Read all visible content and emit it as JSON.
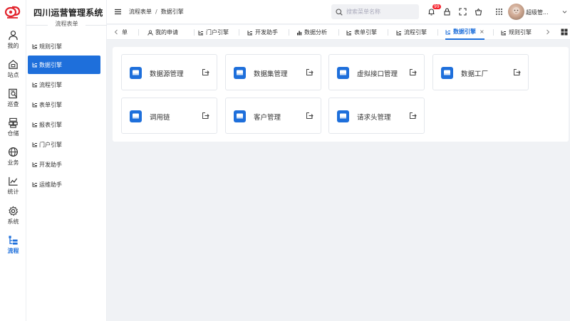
{
  "app": {
    "title": "四川运营管理系统"
  },
  "rail": {
    "items": [
      {
        "label": "我的",
        "icon": "user-icon"
      },
      {
        "label": "站点",
        "icon": "site-icon"
      },
      {
        "label": "巡查",
        "icon": "inspect-icon"
      },
      {
        "label": "仓储",
        "icon": "warehouse-icon"
      },
      {
        "label": "业务",
        "icon": "globe-icon"
      },
      {
        "label": "统计",
        "icon": "chart-icon"
      },
      {
        "label": "系统",
        "icon": "gear-icon"
      },
      {
        "label": "流程",
        "icon": "flow-icon",
        "active": true
      }
    ]
  },
  "sidebar": {
    "heading": "流程表单",
    "items": [
      {
        "label": "规则引擎"
      },
      {
        "label": "数据引擎",
        "active": true
      },
      {
        "label": "流程引擎"
      },
      {
        "label": "表单引擎"
      },
      {
        "label": "报表引擎"
      },
      {
        "label": "门户引擎"
      },
      {
        "label": "开发助手"
      },
      {
        "label": "运维助手"
      }
    ]
  },
  "header": {
    "breadcrumb": [
      "流程表单",
      "数据引擎"
    ],
    "breadcrumb_sep": "/",
    "search_placeholder": "搜索菜单名称",
    "notification_count": "99",
    "username": "超级管..."
  },
  "tabs": [
    {
      "label": "单",
      "icon": "none"
    },
    {
      "label": "我的申请",
      "icon": "user-icon"
    },
    {
      "label": "门户引擎",
      "icon": "flow-icon"
    },
    {
      "label": "开发助手",
      "icon": "flow-icon"
    },
    {
      "label": "数据分析",
      "icon": "bar-icon"
    },
    {
      "label": "表单引擎",
      "icon": "flow-icon"
    },
    {
      "label": "流程引擎",
      "icon": "flow-icon"
    },
    {
      "label": "数据引擎",
      "icon": "flow-icon",
      "active": true,
      "close": "×"
    },
    {
      "label": "规则引擎",
      "icon": "flow-icon"
    }
  ],
  "cards": [
    {
      "label": "数据源管理"
    },
    {
      "label": "数据集管理"
    },
    {
      "label": "虚拟接口管理"
    },
    {
      "label": "数据工厂"
    },
    {
      "label": "调用链"
    },
    {
      "label": "客户管理"
    },
    {
      "label": "请求头管理"
    }
  ],
  "colors": {
    "accent": "#1e6fdb",
    "brand_red": "#e2242d",
    "badge": "#f5222d"
  }
}
